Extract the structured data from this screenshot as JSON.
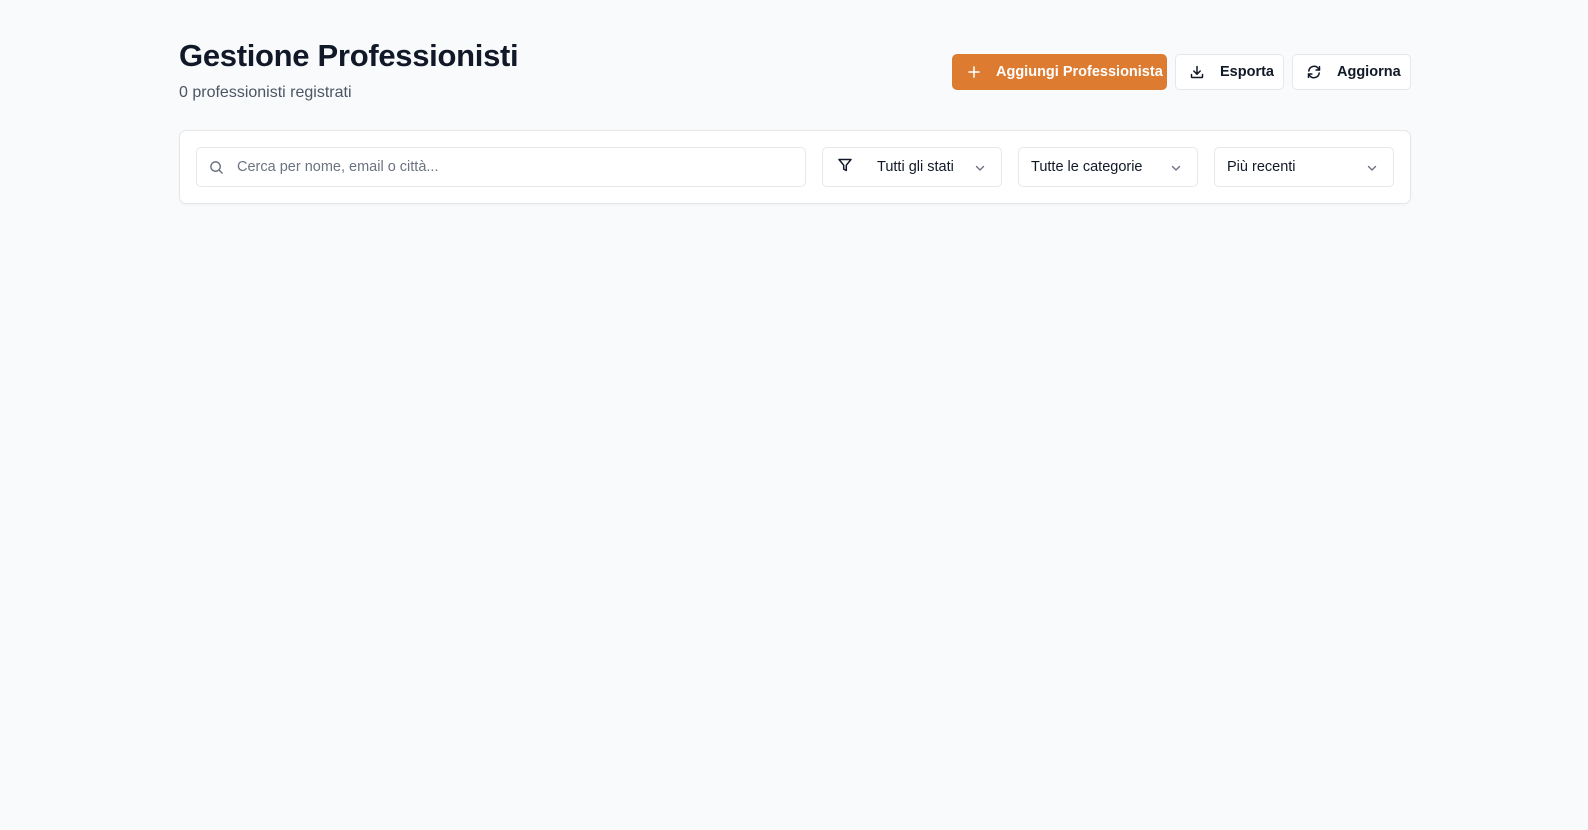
{
  "header": {
    "title": "Gestione Professionisti",
    "subtitle": "0 professionisti registrati"
  },
  "actions": {
    "add_label": "Aggiungi Professionista",
    "export_label": "Esporta",
    "refresh_label": "Aggiorna"
  },
  "filters": {
    "search": {
      "placeholder": "Cerca per nome, email o città...",
      "value": ""
    },
    "status_selected": "Tutti gli stati",
    "category_selected": "Tutte le categorie",
    "sort_selected": "Più recenti"
  },
  "icons": {
    "add": "plus-icon",
    "export": "download-icon",
    "refresh": "refresh-icon",
    "search": "search-icon",
    "filter": "filter-icon",
    "dropdown": "chevron-down-icon"
  },
  "colors": {
    "accent": "#dd7b31",
    "background": "#f8fafb",
    "text": "#111827",
    "muted": "#4b5563",
    "border": "#e4e7ec"
  }
}
